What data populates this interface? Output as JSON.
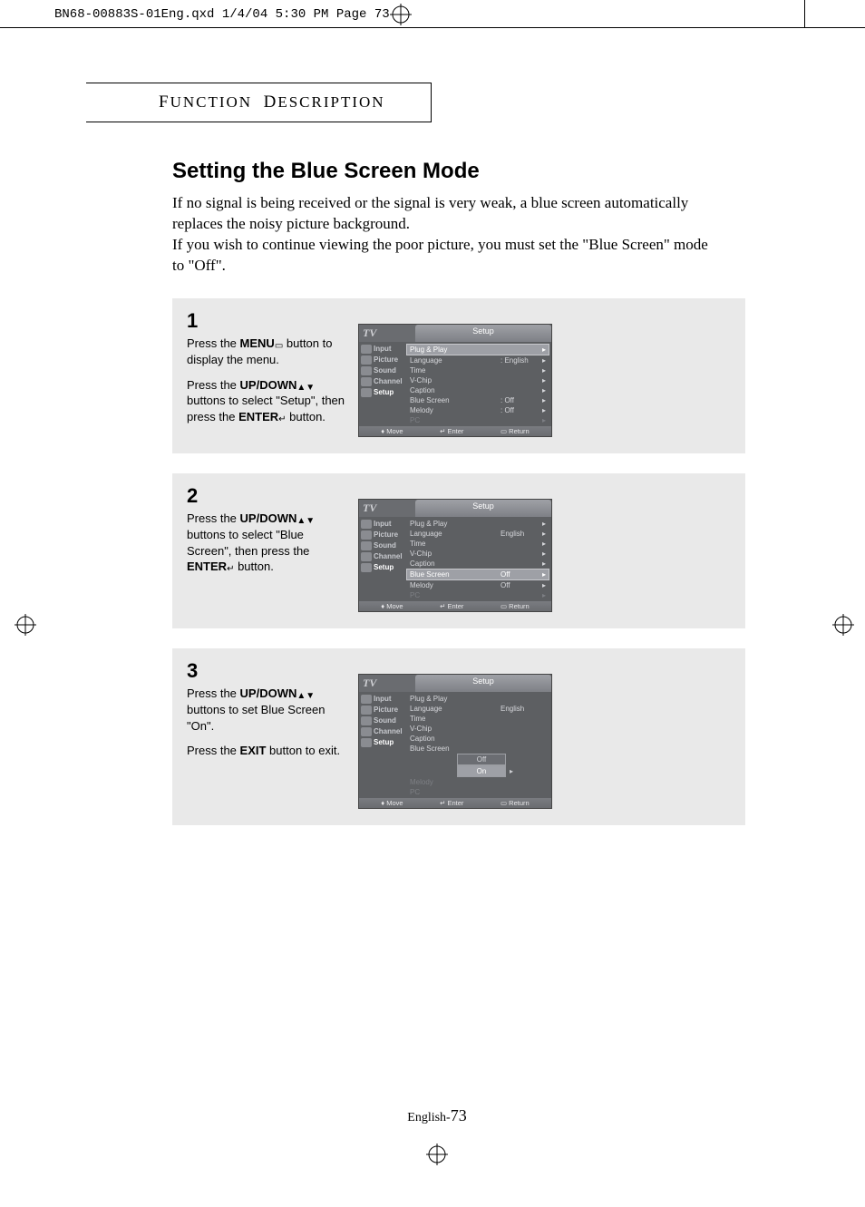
{
  "header_line": "BN68-00883S-01Eng.qxd  1/4/04 5:30 PM  Page 73",
  "section_title": "FUNCTION DESCRIPTION",
  "title": "Setting the Blue Screen Mode",
  "intro1": "If no signal is being received or the signal is very weak, a blue screen automatically replaces the noisy picture background.",
  "intro2": "If you wish to continue viewing the poor picture, you must set the \"Blue Screen\" mode to \"Off\".",
  "steps": [
    {
      "num": "1",
      "paras": [
        [
          {
            "t": "Press the "
          },
          {
            "t": "MENU",
            "b": 1
          },
          {
            "icon": "menu"
          },
          {
            "t": " button to display the menu."
          }
        ],
        [
          {
            "t": "Press the "
          },
          {
            "t": "UP/DOWN",
            "b": 1
          },
          {
            "icon": "ud"
          },
          {
            "t": " buttons to select \"Setup\", then press the "
          },
          {
            "t": "ENTER",
            "b": 1
          },
          {
            "icon": "enter"
          },
          {
            "t": " button."
          }
        ]
      ],
      "tv": {
        "title": "Setup",
        "side_sel": "Setup",
        "rows": [
          {
            "lbl": "Plug & Play",
            "val": "",
            "arr": "▸",
            "hl": 1
          },
          {
            "lbl": "Language",
            "val": ": English",
            "arr": "▸"
          },
          {
            "lbl": "Time",
            "val": "",
            "arr": "▸"
          },
          {
            "lbl": "V-Chip",
            "val": "",
            "arr": "▸"
          },
          {
            "lbl": "Caption",
            "val": "",
            "arr": "▸"
          },
          {
            "lbl": "Blue Screen",
            "val": ": Off",
            "arr": "▸"
          },
          {
            "lbl": "Melody",
            "val": ": Off",
            "arr": "▸"
          },
          {
            "lbl": "PC",
            "val": "",
            "arr": "▸",
            "dim": 1
          }
        ]
      }
    },
    {
      "num": "2",
      "paras": [
        [
          {
            "t": "Press the "
          },
          {
            "t": "UP/DOWN",
            "b": 1
          },
          {
            "icon": "ud"
          },
          {
            "t": " buttons to select \"Blue Screen\", then press the "
          },
          {
            "t": "ENTER",
            "b": 1
          },
          {
            "icon": "enter"
          },
          {
            "t": " button."
          }
        ]
      ],
      "tv": {
        "title": "Setup",
        "side_sel": "Setup",
        "rows": [
          {
            "lbl": "Plug & Play",
            "val": "",
            "arr": "▸"
          },
          {
            "lbl": "Language",
            "val": "English",
            "arr": "▸"
          },
          {
            "lbl": "Time",
            "val": "",
            "arr": "▸"
          },
          {
            "lbl": "V-Chip",
            "val": "",
            "arr": "▸"
          },
          {
            "lbl": "Caption",
            "val": "",
            "arr": "▸"
          },
          {
            "lbl": "Blue Screen",
            "val": "Off",
            "arr": "▸",
            "hl": 1
          },
          {
            "lbl": "Melody",
            "val": "Off",
            "arr": "▸"
          },
          {
            "lbl": "PC",
            "val": "",
            "arr": "▸",
            "dim": 1
          }
        ]
      }
    },
    {
      "num": "3",
      "paras": [
        [
          {
            "t": "Press the "
          },
          {
            "t": "UP/DOWN",
            "b": 1
          },
          {
            "icon": "ud"
          },
          {
            "t": " buttons to set Blue Screen \"On\"."
          }
        ],
        [
          {
            "t": "Press the "
          },
          {
            "t": "EXIT",
            "b": 1
          },
          {
            "t": " button to exit."
          }
        ]
      ],
      "tv": {
        "title": "Setup",
        "side_sel": "Setup",
        "rows": [
          {
            "lbl": "Plug & Play",
            "val": "",
            "arr": ""
          },
          {
            "lbl": "Language",
            "val": "English",
            "arr": ""
          },
          {
            "lbl": "Time",
            "val": "",
            "arr": ""
          },
          {
            "lbl": "V-Chip",
            "val": "",
            "arr": ""
          },
          {
            "lbl": "Caption",
            "val": "",
            "arr": ""
          },
          {
            "lbl": "Blue Screen",
            "val": "",
            "arr": ""
          },
          {
            "lbl": "Melody",
            "val": "",
            "arr": "",
            "dim": 1
          },
          {
            "lbl": "PC",
            "val": "",
            "arr": "",
            "dim": 1
          }
        ],
        "options": [
          "Off",
          "On"
        ],
        "option_sel": "On"
      }
    }
  ],
  "tv_side": [
    "Input",
    "Picture",
    "Sound",
    "Channel",
    "Setup"
  ],
  "tv_foot": {
    "move": "Move",
    "enter": "Enter",
    "return": "Return"
  },
  "tv_logo": "TV",
  "foot_move_icon": "♦",
  "foot_enter_icon": "↵",
  "foot_return_icon": "▭",
  "page_number_prefix": "English-",
  "page_number": "73"
}
